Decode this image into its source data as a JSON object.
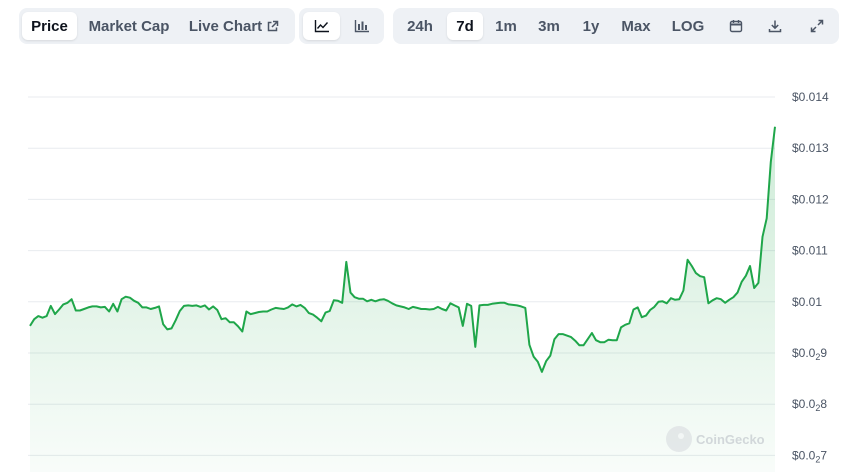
{
  "toolbar": {
    "view_tabs": [
      {
        "label": "Price",
        "active": true
      },
      {
        "label": "Market Cap",
        "active": false
      },
      {
        "label": "Live Chart",
        "active": false,
        "icon": "external-link-icon"
      }
    ],
    "chart_type_buttons": [
      {
        "icon": "line-chart-icon",
        "active": true
      },
      {
        "icon": "candlestick-chart-icon",
        "active": false
      }
    ],
    "ranges": [
      {
        "label": "24h",
        "active": false
      },
      {
        "label": "7d",
        "active": true
      },
      {
        "label": "1m",
        "active": false
      },
      {
        "label": "3m",
        "active": false
      },
      {
        "label": "1y",
        "active": false
      },
      {
        "label": "Max",
        "active": false
      },
      {
        "label": "LOG",
        "active": false
      }
    ],
    "tool_icons": [
      "calendar-icon",
      "download-icon",
      "fullscreen-icon"
    ]
  },
  "chart_data": {
    "type": "area",
    "title": "",
    "xlabel": "",
    "ylabel": "",
    "ylim": [
      7e-07,
      0.014
    ],
    "y_tick_labels": [
      {
        "main": "$0.014",
        "sub": "",
        "tail": ""
      },
      {
        "main": "$0.013",
        "sub": "",
        "tail": ""
      },
      {
        "main": "$0.012",
        "sub": "",
        "tail": ""
      },
      {
        "main": "$0.011",
        "sub": "",
        "tail": ""
      },
      {
        "main": "$0.01",
        "sub": "",
        "tail": ""
      },
      {
        "main": "$0.0",
        "sub": "2",
        "tail": "9"
      },
      {
        "main": "$0.0",
        "sub": "2",
        "tail": "8"
      },
      {
        "main": "$0.0",
        "sub": "2",
        "tail": "7"
      }
    ],
    "grid": true,
    "line_color": "#1fa64a",
    "fill_color": "#1fa64a",
    "series": [
      {
        "values": [
          0.00953,
          0.00966,
          0.00972,
          0.00969,
          0.00972,
          0.00992,
          0.00976,
          0.00985,
          0.00995,
          0.00998,
          0.01005,
          0.00983,
          0.00983,
          0.00986,
          0.00989,
          0.00991,
          0.00991,
          0.00989,
          0.0099,
          0.00981,
          0.00996,
          0.00981,
          0.01005,
          0.0101,
          0.01008,
          0.01002,
          0.00998,
          0.00989,
          0.00989,
          0.00986,
          0.00988,
          0.00991,
          0.00956,
          0.00946,
          0.00948,
          0.00964,
          0.00982,
          0.00992,
          0.00993,
          0.00992,
          0.00993,
          0.0099,
          0.00993,
          0.00985,
          0.00991,
          0.00984,
          0.00966,
          0.00968,
          0.0096,
          0.0096,
          0.00952,
          0.00942,
          0.00981,
          0.00976,
          0.00978,
          0.0098,
          0.00981,
          0.00981,
          0.00985,
          0.00988,
          0.00987,
          0.00986,
          0.00989,
          0.00995,
          0.00991,
          0.00994,
          0.00988,
          0.00978,
          0.00975,
          0.00969,
          0.00962,
          0.00979,
          0.00982,
          0.01003,
          0.01002,
          0.00998,
          0.01078,
          0.01018,
          0.01009,
          0.01006,
          0.01006,
          0.01001,
          0.01004,
          0.01001,
          0.01004,
          0.01005,
          0.01002,
          0.00997,
          0.00993,
          0.00991,
          0.00989,
          0.00986,
          0.0099,
          0.00988,
          0.00986,
          0.00986,
          0.00985,
          0.00986,
          0.0099,
          0.00986,
          0.00983,
          0.00997,
          0.00993,
          0.00989,
          0.00953,
          0.00996,
          0.00992,
          0.00912,
          0.00993,
          0.00994,
          0.00994,
          0.00996,
          0.00997,
          0.00998,
          0.00998,
          0.00995,
          0.00994,
          0.00993,
          0.00991,
          0.00988,
          0.00916,
          0.00893,
          0.00883,
          0.00863,
          0.00884,
          0.00895,
          0.00927,
          0.00937,
          0.00937,
          0.00934,
          0.00931,
          0.00924,
          0.00915,
          0.00915,
          0.00927,
          0.00939,
          0.00925,
          0.00921,
          0.00921,
          0.00926,
          0.00925,
          0.00925,
          0.0095,
          0.00955,
          0.00958,
          0.00985,
          0.00989,
          0.0097,
          0.00973,
          0.00984,
          0.0099,
          0.01,
          0.01001,
          0.00997,
          0.01007,
          0.01004,
          0.01005,
          0.01022,
          0.01082,
          0.0107,
          0.01056,
          0.0105,
          0.01048,
          0.00997,
          0.01003,
          0.01007,
          0.01005,
          0.00998,
          0.01004,
          0.01009,
          0.01018,
          0.01039,
          0.01051,
          0.0107,
          0.01027,
          0.01037,
          0.01127,
          0.01163,
          0.01273,
          0.01342
        ]
      }
    ],
    "watermark": "CoinGecko"
  }
}
